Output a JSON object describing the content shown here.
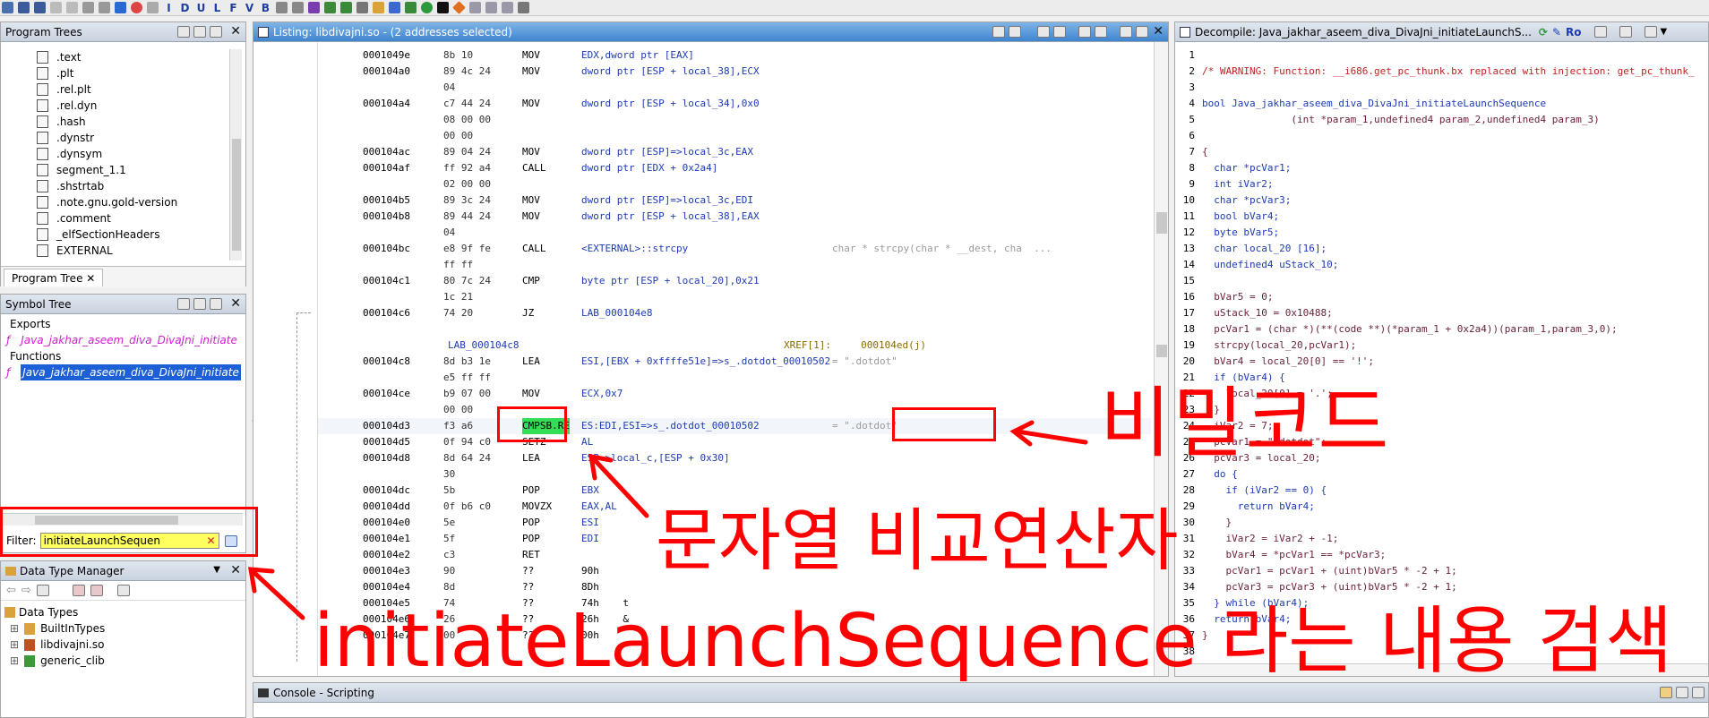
{
  "toolbar": {
    "letters": [
      "I",
      "D",
      "U",
      "L",
      "F",
      "V",
      "B"
    ]
  },
  "program_trees": {
    "title": "Program Trees",
    "items": [
      ".text",
      ".plt",
      ".rel.plt",
      ".rel.dyn",
      ".hash",
      ".dynstr",
      ".dynsym",
      "segment_1.1",
      ".shstrtab",
      ".note.gnu.gold-version",
      ".comment",
      "_elfSectionHeaders",
      "EXTERNAL"
    ],
    "tab_label": "Program Tree"
  },
  "symbol_tree": {
    "title": "Symbol Tree",
    "exports_label": "Exports",
    "exports_item": "Java_jakhar_aseem_diva_DivaJni_initiate",
    "functions_label": "Functions",
    "functions_item": "Java_jakhar_aseem_diva_DivaJni_initiate",
    "filter_label": "Filter:",
    "filter_value": "initiateLaunchSequen"
  },
  "data_type_manager": {
    "title": "Data Type Manager",
    "root": "Data Types",
    "items": [
      "BuiltInTypes",
      "libdivajni.so",
      "generic_clib"
    ]
  },
  "listing": {
    "title": "Listing:  libdivajni.so - (2 addresses selected)",
    "rows": [
      {
        "addr": "0001049e",
        "bytes": "8b 10",
        "mn": "MOV",
        "op": "EDX,dword ptr [EAX]",
        "cm": ""
      },
      {
        "addr": "000104a0",
        "bytes": "89 4c 24",
        "mn": "MOV",
        "op": "dword ptr [ESP + local_38],ECX",
        "cm": ""
      },
      {
        "addr": "",
        "bytes": "04",
        "mn": "",
        "op": "",
        "cm": ""
      },
      {
        "addr": "000104a4",
        "bytes": "c7 44 24",
        "mn": "MOV",
        "op": "dword ptr [ESP + local_34],0x0",
        "cm": ""
      },
      {
        "addr": "",
        "bytes": "08 00 00",
        "mn": "",
        "op": "",
        "cm": ""
      },
      {
        "addr": "",
        "bytes": "00 00",
        "mn": "",
        "op": "",
        "cm": ""
      },
      {
        "addr": "000104ac",
        "bytes": "89 04 24",
        "mn": "MOV",
        "op": "dword ptr [ESP]=>local_3c,EAX",
        "cm": ""
      },
      {
        "addr": "000104af",
        "bytes": "ff 92 a4",
        "mn": "CALL",
        "op": "dword ptr [EDX + 0x2a4]",
        "cm": ""
      },
      {
        "addr": "",
        "bytes": "02 00 00",
        "mn": "",
        "op": "",
        "cm": ""
      },
      {
        "addr": "000104b5",
        "bytes": "89 3c 24",
        "mn": "MOV",
        "op": "dword ptr [ESP]=>local_3c,EDI",
        "cm": ""
      },
      {
        "addr": "000104b8",
        "bytes": "89 44 24",
        "mn": "MOV",
        "op": "dword ptr [ESP + local_38],EAX",
        "cm": ""
      },
      {
        "addr": "",
        "bytes": "04",
        "mn": "",
        "op": "",
        "cm": ""
      },
      {
        "addr": "000104bc",
        "bytes": "e8 9f fe",
        "mn": "CALL",
        "op": "<EXTERNAL>::strcpy",
        "cm": "char * strcpy(char * __dest, cha  ..."
      },
      {
        "addr": "",
        "bytes": "ff ff",
        "mn": "",
        "op": "",
        "cm": ""
      },
      {
        "addr": "000104c1",
        "bytes": "80 7c 24",
        "mn": "CMP",
        "op": "byte ptr [ESP + local_20],0x21",
        "cm": ""
      },
      {
        "addr": "",
        "bytes": "1c 21",
        "mn": "",
        "op": "",
        "cm": ""
      },
      {
        "addr": "000104c6",
        "bytes": "74 20",
        "mn": "JZ",
        "op": "LAB_000104e8",
        "cm": ""
      },
      {
        "addr": "",
        "bytes": "",
        "mn": "",
        "op": "",
        "cm": ""
      },
      {
        "label": "LAB_000104c8",
        "xref": "XREF[1]:     000104ed(j)"
      },
      {
        "addr": "000104c8",
        "bytes": "8d b3 1e",
        "mn": "LEA",
        "op": "ESI,[EBX + 0xffffe51e]=>s_.dotdot_00010502",
        "cm": "= \".dotdot\""
      },
      {
        "addr": "",
        "bytes": "e5 ff ff",
        "mn": "",
        "op": "",
        "cm": ""
      },
      {
        "addr": "000104ce",
        "bytes": "b9 07 00",
        "mn": "MOV",
        "op": "ECX,0x7",
        "cm": ""
      },
      {
        "addr": "",
        "bytes": "00 00",
        "mn": "",
        "op": "",
        "cm": ""
      },
      {
        "addr": "000104d3",
        "bytes": "f3 a6",
        "mn": "CMPSB.RE",
        "op": "ES:EDI,ESI=>s_.dotdot_00010502",
        "cm": "= \".dotdot\""
      },
      {
        "addr": "000104d5",
        "bytes": "0f 94 c0",
        "mn": "SETZ",
        "op": "AL",
        "cm": ""
      },
      {
        "addr": "000104d8",
        "bytes": "8d 64 24",
        "mn": "LEA",
        "op": "ESP=>local_c,[ESP + 0x30]",
        "cm": ""
      },
      {
        "addr": "",
        "bytes": "30",
        "mn": "",
        "op": "",
        "cm": ""
      },
      {
        "addr": "000104dc",
        "bytes": "5b",
        "mn": "POP",
        "op": "EBX",
        "cm": ""
      },
      {
        "addr": "000104dd",
        "bytes": "0f b6 c0",
        "mn": "MOVZX",
        "op": "EAX,AL",
        "cm": ""
      },
      {
        "addr": "000104e0",
        "bytes": "5e",
        "mn": "POP",
        "op": "ESI",
        "cm": ""
      },
      {
        "addr": "000104e1",
        "bytes": "5f",
        "mn": "POP",
        "op": "EDI",
        "cm": ""
      },
      {
        "addr": "000104e2",
        "bytes": "c3",
        "mn": "RET",
        "op": "",
        "cm": ""
      },
      {
        "addr": "000104e3",
        "bytes": "90",
        "mn": "??",
        "op": "90h",
        "cm": ""
      },
      {
        "addr": "000104e4",
        "bytes": "8d",
        "mn": "??",
        "op": "8Dh",
        "cm": ""
      },
      {
        "addr": "000104e5",
        "bytes": "74",
        "mn": "??",
        "op": "74h    t",
        "cm": ""
      },
      {
        "addr": "000104e6",
        "bytes": "26",
        "mn": "??",
        "op": "26h    &",
        "cm": ""
      },
      {
        "addr": "000104e7",
        "bytes": "00",
        "mn": "??",
        "op": "00h",
        "cm": ""
      }
    ]
  },
  "decompile": {
    "title": "Decompile: Java_jakhar_aseem_diva_DivaJni_initiateLaunchS...",
    "ro": "Ro",
    "lines": [
      "",
      "/* WARNING: Function: __i686.get_pc_thunk.bx replaced with injection: get_pc_thunk_",
      "",
      "bool Java_jakhar_aseem_diva_DivaJni_initiateLaunchSequence",
      "               (int *param_1,undefined4 param_2,undefined4 param_3)",
      "",
      "{",
      "  char *pcVar1;",
      "  int iVar2;",
      "  char *pcVar3;",
      "  bool bVar4;",
      "  byte bVar5;",
      "  char local_20 [16];",
      "  undefined4 uStack_10;",
      "",
      "  bVar5 = 0;",
      "  uStack_10 = 0x10488;",
      "  pcVar1 = (char *)(**(code **)(*param_1 + 0x2a4))(param_1,param_3,0);",
      "  strcpy(local_20,pcVar1);",
      "  bVar4 = local_20[0] == '!';",
      "  if (bVar4) {",
      "    local_20[0] = '.';",
      "  }",
      "  iVar2 = 7;",
      "  pcVar1 = \".dotdot\";",
      "  pcVar3 = local_20;",
      "  do {",
      "    if (iVar2 == 0) {",
      "      return bVar4;",
      "    }",
      "    iVar2 = iVar2 + -1;",
      "    bVar4 = *pcVar1 == *pcVar3;",
      "    pcVar1 = pcVar1 + (uint)bVar5 * -2 + 1;",
      "    pcVar3 = pcVar3 + (uint)bVar5 * -2 + 1;",
      "  } while (bVar4);",
      "  return bVar4;",
      "}",
      ""
    ]
  },
  "console": {
    "title": "Console - Scripting"
  },
  "annotations": {
    "secret_code": "비밀코드",
    "string_compare": "문자열 비교연산자",
    "search_text": "initiateLaunchSequence 라는 내용 검색"
  }
}
